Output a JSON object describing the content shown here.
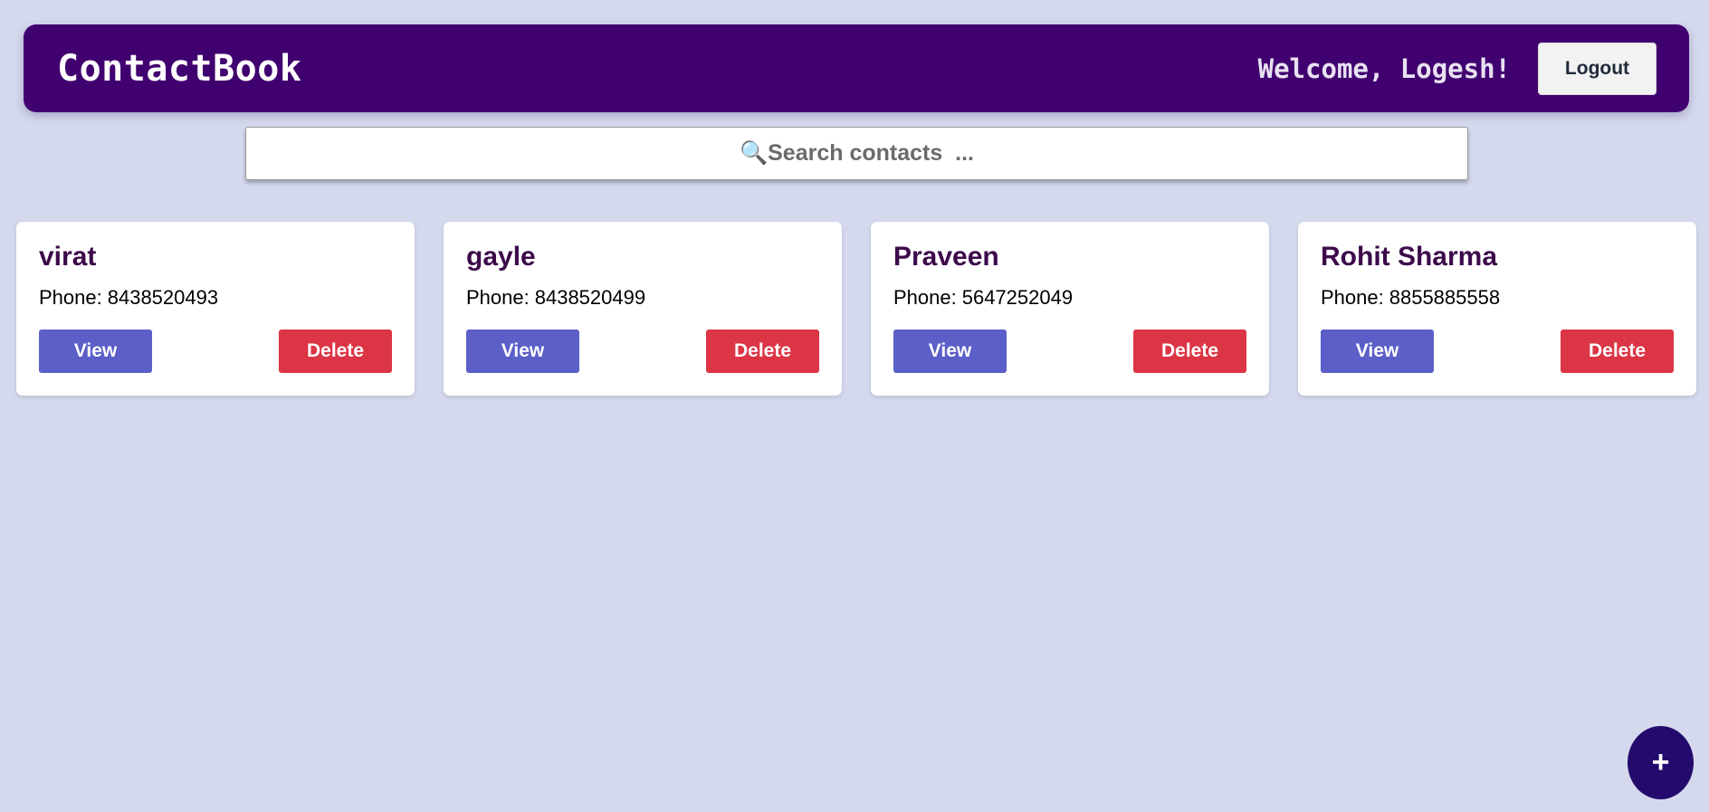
{
  "header": {
    "logo": "ContactBook",
    "welcome": "Welcome, Logesh!",
    "logout_label": "Logout"
  },
  "search": {
    "placeholder": "🔍Search contacts  ...",
    "icon": "magnifier-icon"
  },
  "contacts": [
    {
      "name": "virat",
      "phone_label": "Phone:",
      "phone": "8438520493",
      "view_label": "View",
      "delete_label": "Delete"
    },
    {
      "name": "gayle",
      "phone_label": "Phone:",
      "phone": "8438520499",
      "view_label": "View",
      "delete_label": "Delete"
    },
    {
      "name": "Praveen",
      "phone_label": "Phone:",
      "phone": "5647252049",
      "view_label": "View",
      "delete_label": "Delete"
    },
    {
      "name": "Rohit Sharma",
      "phone_label": "Phone:",
      "phone": "8855885558",
      "view_label": "View",
      "delete_label": "Delete"
    }
  ],
  "fab": {
    "label": "+",
    "icon": "plus-icon"
  },
  "colors": {
    "background": "#d4d9ed",
    "header": "#41006f",
    "view_button": "#5b5fc7",
    "delete_button": "#dc3545",
    "fab": "#230a6c",
    "contact_name": "#3c0a4a"
  }
}
